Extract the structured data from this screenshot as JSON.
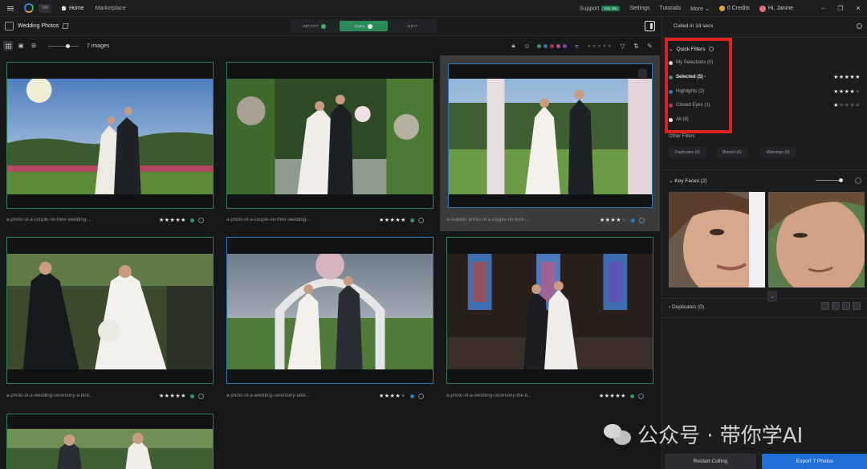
{
  "topbar": {
    "app_badge": "NM",
    "home": "Home",
    "marketplace": "Marketplace",
    "support": "Support",
    "support_badge": "ONLINE",
    "settings": "Settings",
    "tutorials": "Tutorials",
    "more": "More ⌄",
    "credits": "0 Credits",
    "user": "Hi, Janine"
  },
  "project": {
    "title": "Wedding Photos",
    "steps": [
      "IMPORT",
      "CULL",
      "EDIT"
    ]
  },
  "toolbar": {
    "image_count": "7 images"
  },
  "photos": [
    {
      "name": "a-photo-of-a-couple-on-their-wedding-...",
      "stars": 5,
      "label_color": "#2f9a63"
    },
    {
      "name": "a-photo-of-a-couple-on-their-wedding-...",
      "stars": 5,
      "label_color": "#2f9a63"
    },
    {
      "name": "a-realistic-photo-of-a-couple-on-their-...",
      "stars": 4,
      "label_color": "#2d79b9"
    },
    {
      "name": "a-photo-of-a-wedding-ceremony-a-brid...",
      "stars": 5,
      "label_color": "#2f9a63"
    },
    {
      "name": "a-photo-of-a-wedding-ceremony-take...",
      "stars": 4,
      "label_color": "#2d79b9"
    },
    {
      "name": "a-photo-of-a-wedding-ceremony-the-b...",
      "stars": 5,
      "label_color": "#2f9a63"
    }
  ],
  "panel": {
    "culled": "Culled in 14 secs",
    "quick_filters": "Quick Filters",
    "filters": [
      {
        "label": "My Selections (0)",
        "color": "#d8d9db"
      },
      {
        "label": "Selected (5) ·",
        "color": "#2f9a63"
      },
      {
        "label": "Highlights (2)",
        "color": "#2d79b9"
      },
      {
        "label": "Closed Eyes (1)",
        "color": "#b1334e"
      },
      {
        "label": "All (8)",
        "color": "#ffffff"
      }
    ],
    "other_filters": "Other Filters",
    "chips": [
      "Duplicates (0)",
      "Blurred (0)",
      "Warnings (0)"
    ],
    "key_faces": "Key Faces (2)",
    "duplicates": "Duplicates (0)",
    "restart": "Restart Culling",
    "export": "Export 7 Photos"
  },
  "watermark": "公众号 · 带你学AI"
}
